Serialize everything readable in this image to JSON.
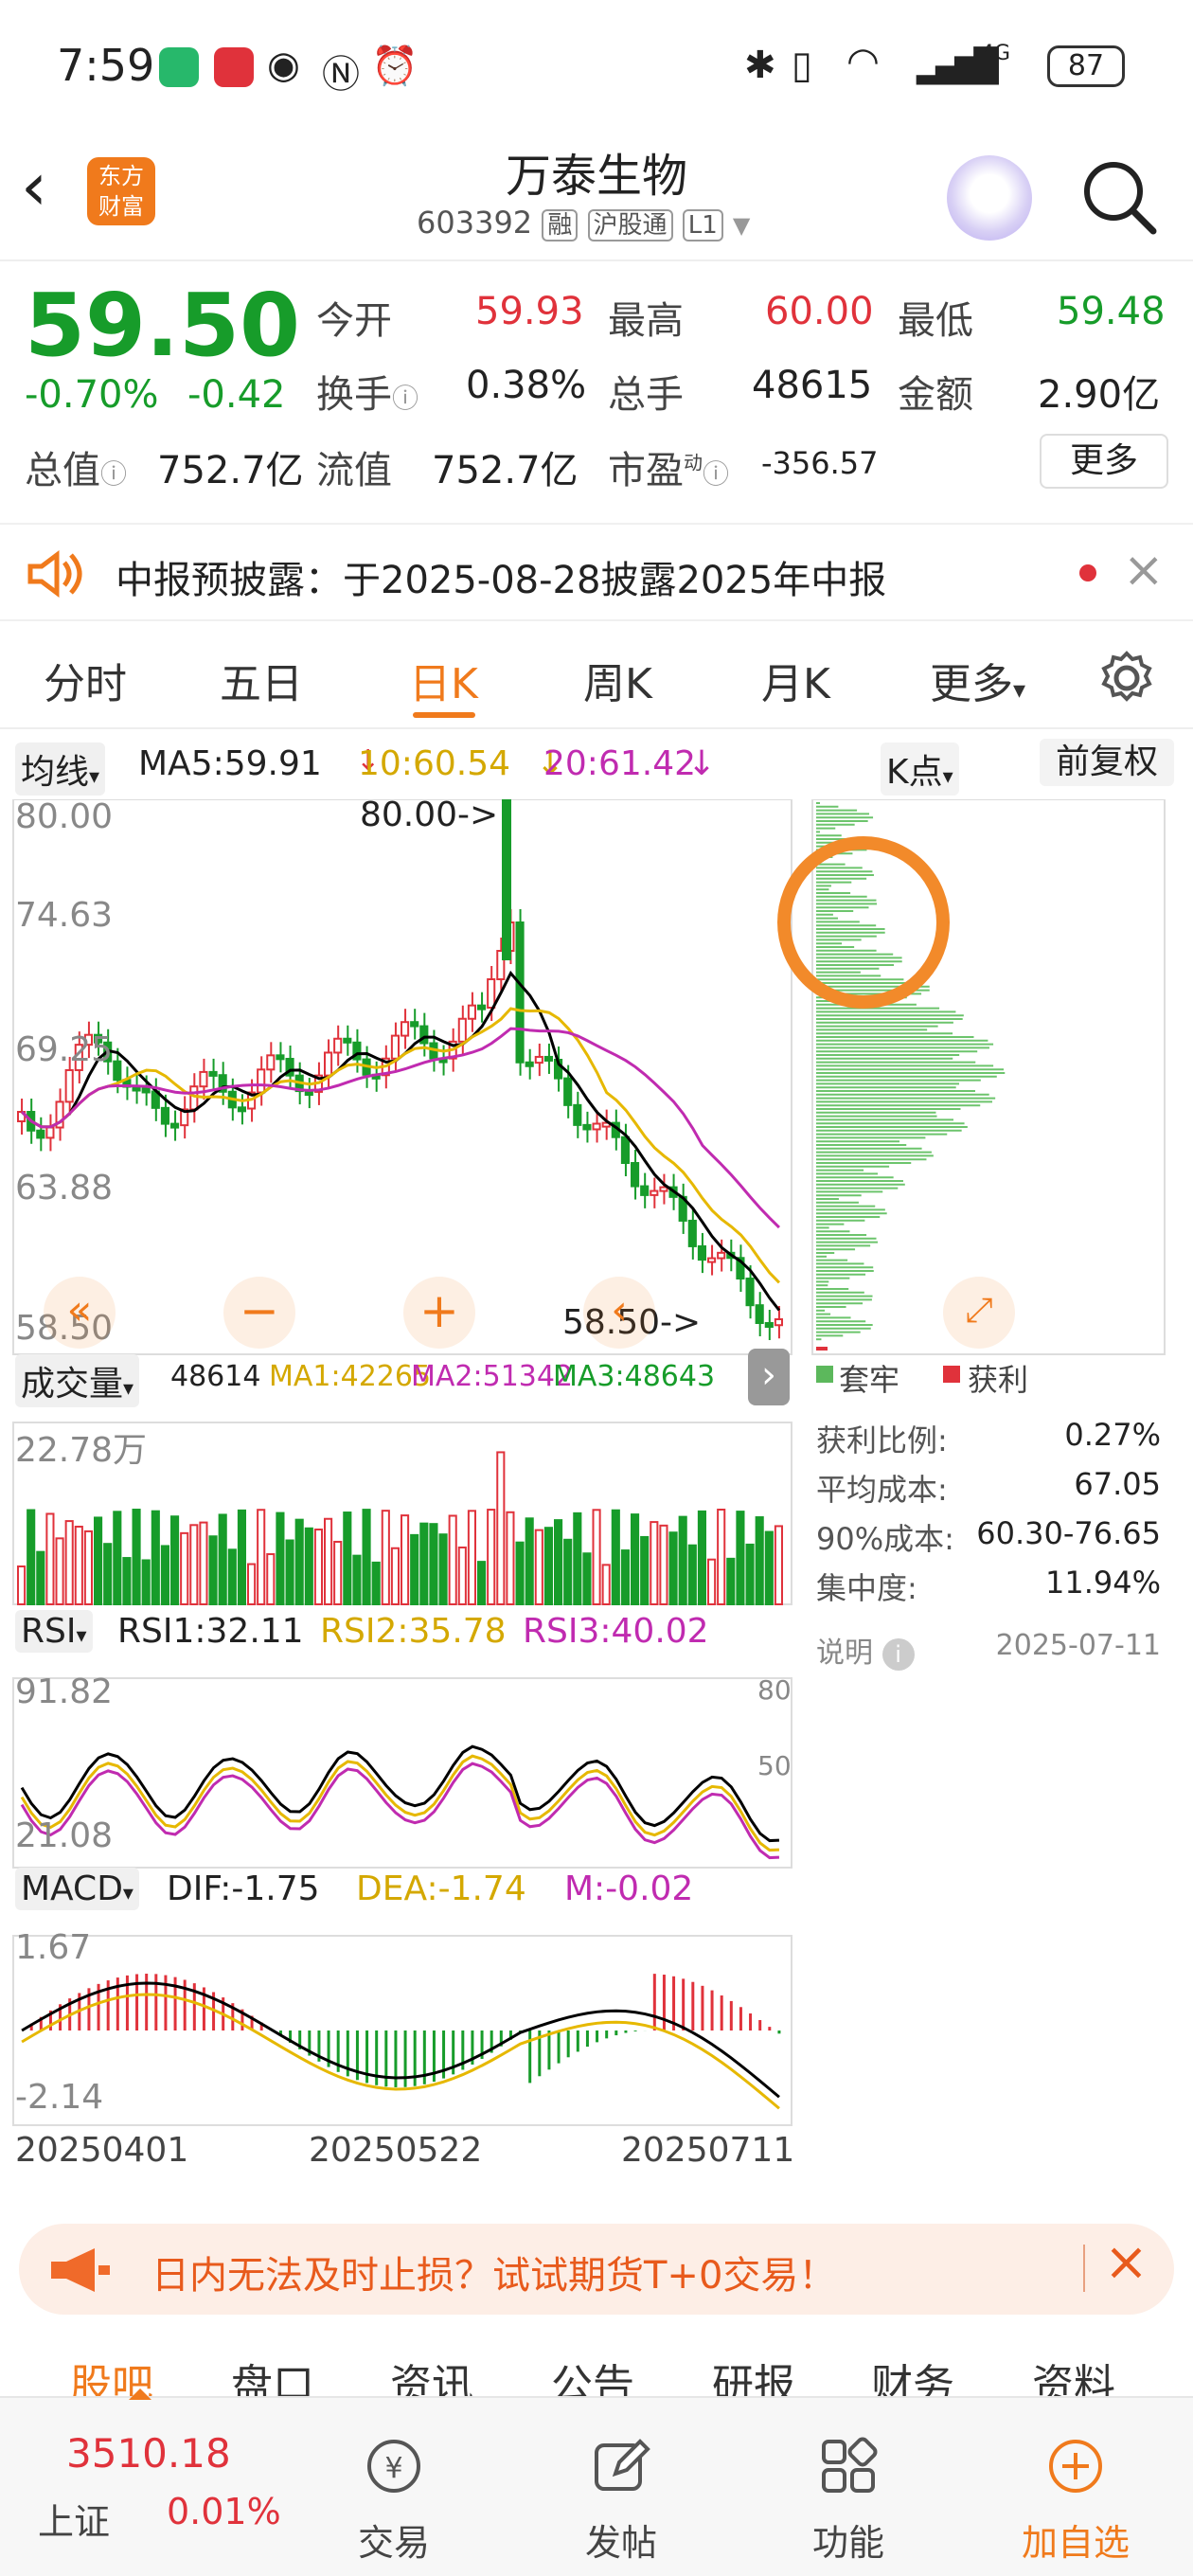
{
  "status": {
    "time": "7:59",
    "battery": "87",
    "net": "4G"
  },
  "header": {
    "title": "万泰生物",
    "code": "603392",
    "tags": [
      "融",
      "沪股通",
      "L1"
    ],
    "logo_line1": "东方",
    "logo_line2": "财富"
  },
  "quote": {
    "price": "59.50",
    "change_pct": "-0.70%",
    "change": "-0.42",
    "open_label": "今开",
    "open": "59.93",
    "high_label": "最高",
    "high": "60.00",
    "low_label": "最低",
    "low": "59.48",
    "turnover_label": "换手",
    "turnover": "0.38%",
    "volume_label": "总手",
    "volume": "48615",
    "amount_label": "金额",
    "amount": "2.90亿",
    "mktcap_label": "总值",
    "mktcap": "752.7亿",
    "float_label": "流值",
    "float": "752.7亿",
    "pe_label": "市盈",
    "pe_sup": "动",
    "pe": "-356.57",
    "more": "更多"
  },
  "notice": {
    "text": "中报预披露：于2025-08-28披露2025年中报"
  },
  "tabs": [
    "分时",
    "五日",
    "日K",
    "周K",
    "月K",
    "更多"
  ],
  "active_tab": "日K",
  "kline": {
    "ma_select": "均线",
    "ma5": "MA5:59.91",
    "ma10": "10:60.54",
    "ma20": "20:61.42",
    "mode_select": "K点",
    "fq": "前复权",
    "y_labels": [
      "80.00",
      "74.63",
      "69.25",
      "63.88",
      "58.50"
    ],
    "max_marker": "80.00->",
    "min_marker": "58.50->"
  },
  "volume": {
    "select": "成交量",
    "v": "48614",
    "ma1": "MA1:42265",
    "ma2": "MA2:51342",
    "ma3": "MA3:48643",
    "top": "22.78万"
  },
  "rsi": {
    "select": "RSI",
    "r1": "RSI1:32.11",
    "r2": "RSI2:35.78",
    "r3": "RSI3:40.02",
    "top": "91.82",
    "bottom": "21.08",
    "l80": "80",
    "l50": "50"
  },
  "macd": {
    "select": "MACD",
    "dif": "DIF:-1.75",
    "dea": "DEA:-1.74",
    "m": "M:-0.02",
    "top": "1.67",
    "bottom": "-2.14"
  },
  "dates": [
    "20250401",
    "20250522",
    "20250711"
  ],
  "chip": {
    "legend_trap": "套牢",
    "legend_profit": "获利",
    "rows": [
      {
        "label": "获利比例:",
        "value": "0.27%"
      },
      {
        "label": "平均成本:",
        "value": "67.05"
      },
      {
        "label": "90%成本:",
        "value": "60.30-76.65"
      },
      {
        "label": "集中度:",
        "value": "11.94%"
      }
    ],
    "note": "说明",
    "date": "2025-07-11"
  },
  "banner": {
    "text": "日内无法及时止损？试试期货T+0交易！"
  },
  "bottom_tabs": [
    "股吧",
    "盘口",
    "资讯",
    "公告",
    "研报",
    "财务",
    "资料"
  ],
  "bottombar": {
    "index_value": "3510.18",
    "index_name": "上证",
    "index_change": "0.01%",
    "items": [
      "交易",
      "发帖",
      "功能",
      "加自选"
    ]
  },
  "colors": {
    "up": "#e0323b",
    "down": "#179c2a",
    "accent": "#f07a1c",
    "ma5": "#000000",
    "ma10": "#e6b800",
    "ma20": "#c02bb0"
  }
}
